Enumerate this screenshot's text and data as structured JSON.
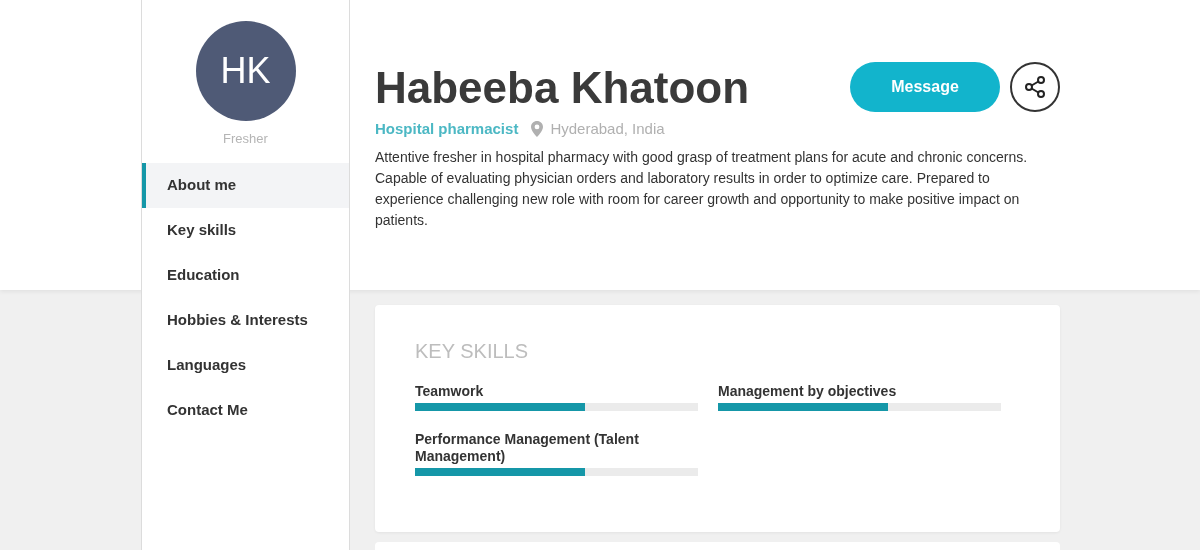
{
  "sidebar": {
    "avatar_initials": "HK",
    "status": "Fresher",
    "items": [
      {
        "label": "About me",
        "selected": true
      },
      {
        "label": "Key skills",
        "selected": false
      },
      {
        "label": "Education",
        "selected": false
      },
      {
        "label": "Hobbies & Interests",
        "selected": false
      },
      {
        "label": "Languages",
        "selected": false
      },
      {
        "label": "Contact Me",
        "selected": false
      }
    ]
  },
  "profile": {
    "name": "Habeeba Khatoon",
    "title": "Hospital pharmacist",
    "location": "Hyderabad, India",
    "summary": "Attentive fresher in hospital pharmacy with good grasp of treatment plans for acute and chronic concerns. Capable of evaluating physician orders and laboratory results in order to optimize care. Prepared to experience challenging new role with room for career growth and opportunity to make positive impact on patients.",
    "message_button": "Message"
  },
  "key_skills": {
    "heading": "KEY SKILLS",
    "skills": [
      {
        "name": "Teamwork",
        "level": 0.6
      },
      {
        "name": "Management by objectives",
        "level": 0.6
      },
      {
        "name": "Performance Management (Talent Management)",
        "level": 0.6
      }
    ]
  }
}
